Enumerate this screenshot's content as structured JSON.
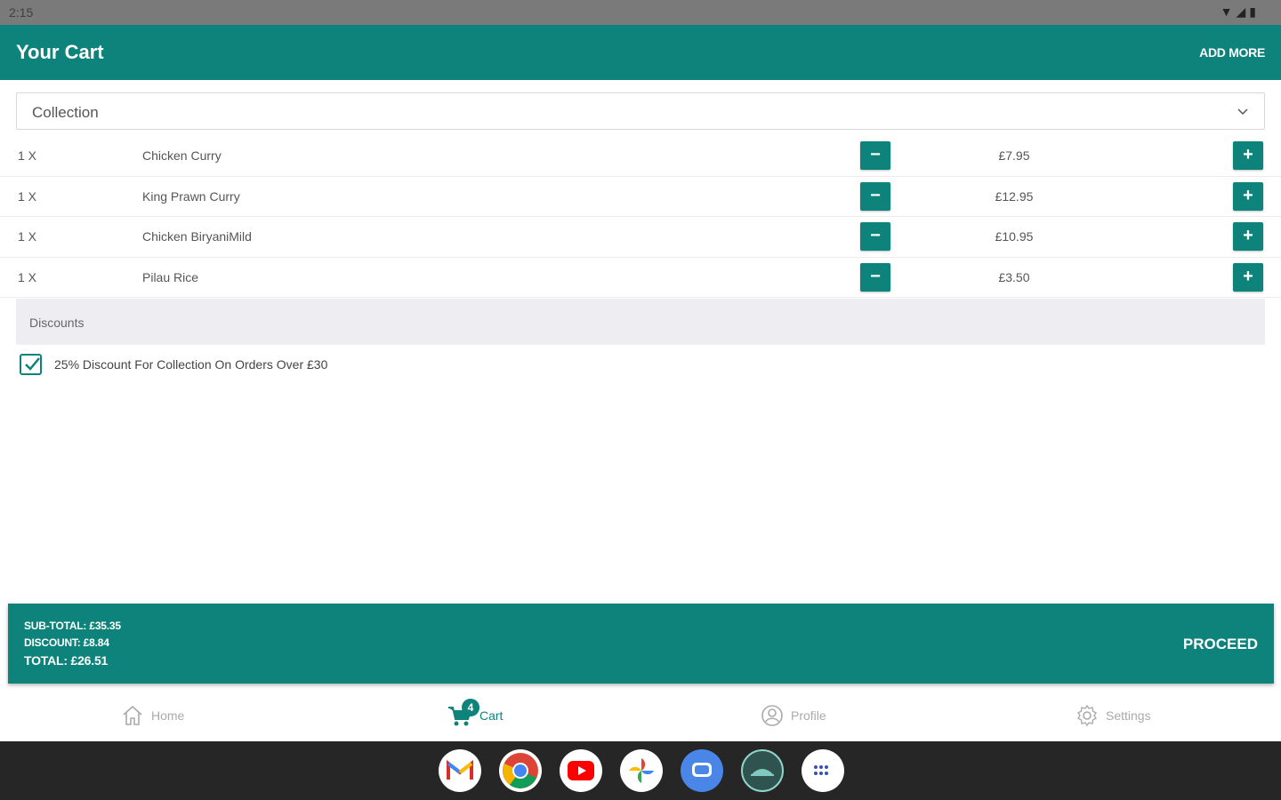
{
  "status_bar": {
    "time": "2:15"
  },
  "app_bar": {
    "title": "Your Cart",
    "add_more": "ADD MORE"
  },
  "order_type": {
    "selected": "Collection"
  },
  "cart_items": [
    {
      "qty": "1 X",
      "name": "Chicken Curry",
      "price": "£7.95"
    },
    {
      "qty": "1 X",
      "name": "King Prawn Curry",
      "price": "£12.95"
    },
    {
      "qty": "1 X",
      "name": "Chicken BiryaniMild",
      "price": "£10.95"
    },
    {
      "qty": "1 X",
      "name": "Pilau Rice",
      "price": "£3.50"
    }
  ],
  "buttons": {
    "minus": "−",
    "plus": "+"
  },
  "discounts": {
    "header": "Discounts",
    "items": [
      {
        "label": "25% Discount For Collection On Orders Over £30",
        "checked": true
      }
    ]
  },
  "summary": {
    "subtotal": "SUB-TOTAL: £35.35",
    "discount": "DISCOUNT: £8.84",
    "total": "TOTAL: £26.51",
    "proceed": "PROCEED"
  },
  "bottom_nav": {
    "items": [
      {
        "label": "Home",
        "icon": "home-icon"
      },
      {
        "label": "Cart",
        "icon": "cart-icon",
        "badge": "4",
        "active": true
      },
      {
        "label": "Profile",
        "icon": "profile-icon"
      },
      {
        "label": "Settings",
        "icon": "gear-icon"
      }
    ]
  },
  "dock": {
    "apps": [
      {
        "name": "gmail-icon",
        "glyph": "M"
      },
      {
        "name": "chrome-icon",
        "glyph": ""
      },
      {
        "name": "youtube-icon",
        "glyph": "▶"
      },
      {
        "name": "photos-icon",
        "glyph": ""
      },
      {
        "name": "messages-icon",
        "glyph": ""
      },
      {
        "name": "restaurant-app-icon",
        "glyph": ""
      },
      {
        "name": "app-drawer-icon",
        "glyph": "⋮⋮"
      }
    ]
  },
  "colors": {
    "primary": "#0e837b",
    "status_bar": "#7a7a7a",
    "dock": "#262626",
    "discount_bg": "#ededf2"
  }
}
